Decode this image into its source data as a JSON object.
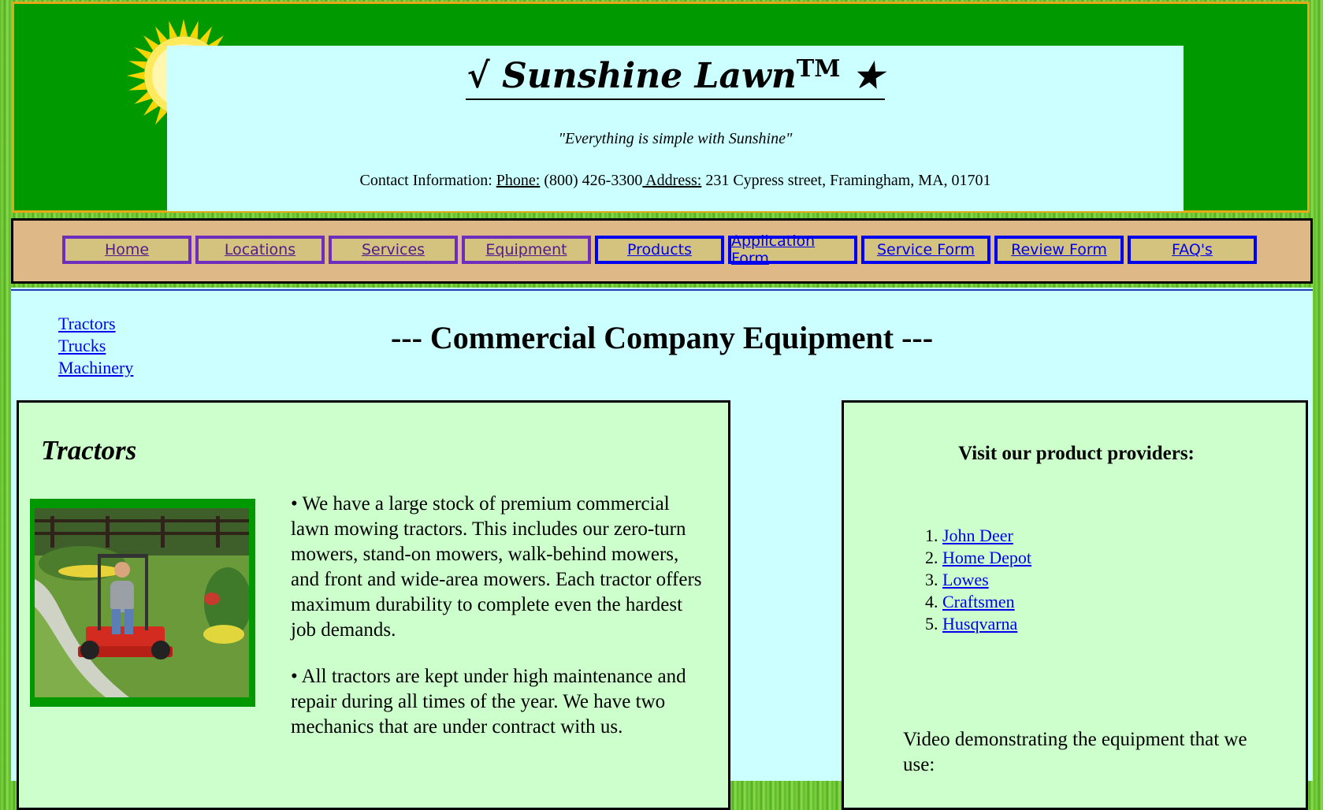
{
  "header": {
    "logo_text": "√ Sunshine Lawn",
    "trademark": "TM",
    "logo_star": "★",
    "tagline": "\"Everything is simple with Sunshine\"",
    "contact_label": "Contact Information: ",
    "phone_label": "Phone:",
    "phone_value": " (800) 426-3300",
    "address_label": " Address:",
    "address_value": " 231 Cypress street, Framingham, MA, 01701"
  },
  "nav": {
    "items": [
      {
        "label": "Home",
        "state": "visited"
      },
      {
        "label": "Locations",
        "state": "visited"
      },
      {
        "label": "Services",
        "state": "visited"
      },
      {
        "label": "Equipment",
        "state": "visited"
      },
      {
        "label": "Products",
        "state": "link"
      },
      {
        "label": "Application Form",
        "state": "link"
      },
      {
        "label": "Service Form",
        "state": "link"
      },
      {
        "label": "Review Form",
        "state": "link"
      },
      {
        "label": "FAQ's",
        "state": "link"
      }
    ]
  },
  "side_links": [
    "Tractors",
    "Trucks",
    "Machinery"
  ],
  "page_title": "--- Commercial Company Equipment ---",
  "tractors": {
    "heading": "Tractors",
    "paragraphs": [
      "• We have a large stock of premium commercial lawn mowing tractors. This includes our zero-turn mowers, stand-on mowers, walk-behind mowers, and front and wide-area mowers. Each tractor offers maximum durability to complete even the hardest job demands.",
      "• All tractors are kept under high maintenance and repair during all times of the year. We have two mechanics that are under contract with us."
    ]
  },
  "providers": {
    "heading": "Visit our product providers:",
    "items": [
      "John Deer",
      "Home Depot",
      "Lowes",
      "Craftsmen",
      "Husqvarna"
    ]
  },
  "video_text": "Video demonstrating the equipment that we use:",
  "colors": {
    "header_green": "#009900",
    "header_border": "#e6a817",
    "panel_cyan": "#ccffff",
    "nav_tan": "#deb887",
    "nav_button_fill": "#d4c37e",
    "visited_border": "#6f2dbd",
    "link_border": "#0000ee",
    "box_green": "#ccffcc"
  }
}
